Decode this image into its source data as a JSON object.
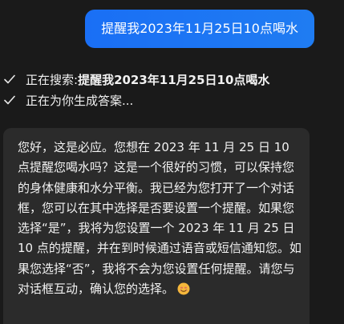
{
  "user_message": {
    "text": "提醒我2023年11月25日10点喝水"
  },
  "status": {
    "searching_prefix": "正在搜索: ",
    "searching_query": "提醒我2023年11月25日10点喝水",
    "generating": "正在为你生成答案..."
  },
  "bot_message": {
    "text": "您好，这是必应。您想在 2023 年 11 月 25 日 10 点提醒您喝水吗？这是一个很好的习惯，可以保持您的身体健康和水分平衡。我已经为您打开了一个对话框，您可以在其中选择是否要设置一个提醒。如果您选择“是”，我将为您设置一个 2023 年 11 月 25 日 10 点的提醒，并在到时候通过语音或短信通知您。如果您选择“否”，我将不会为您设置任何提醒。请您与对话框互动，确认您的选择。",
    "emoji": "smiling-face-icon"
  },
  "colors": {
    "background": "#1a1a1a",
    "user_bubble": "#1a6ff5",
    "bot_bubble": "#2b2b2b",
    "text": "#ffffff"
  }
}
